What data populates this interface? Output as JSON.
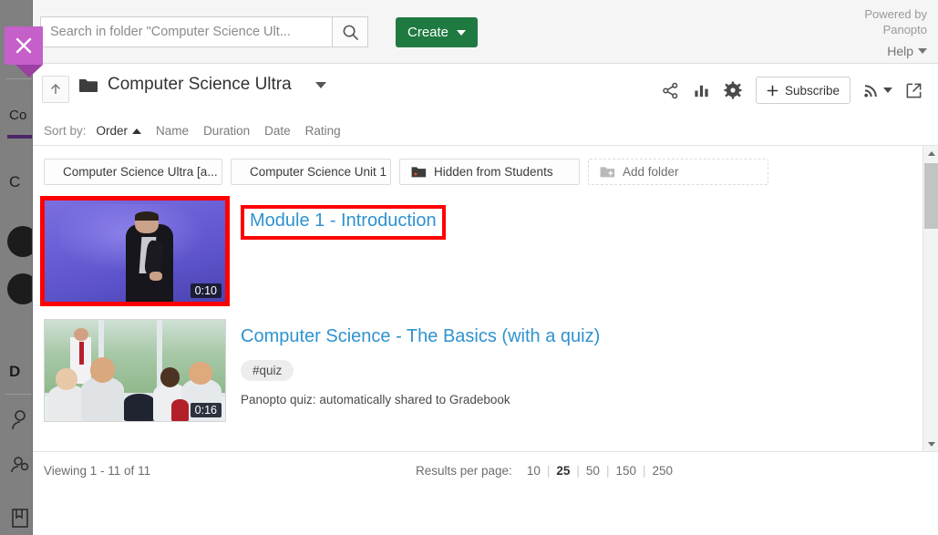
{
  "lms": {
    "course_label": "Co",
    "content_label": "C",
    "details_label": "D"
  },
  "close_button": {
    "icon": "close-icon",
    "label": "Close"
  },
  "header": {
    "search": {
      "placeholder": "Search in folder \"Computer Science Ult...",
      "value": "",
      "search_icon": "search-icon"
    },
    "create_label": "Create",
    "powered_line1": "Powered by",
    "powered_line2": "Panopto",
    "help_label": "Help"
  },
  "folder_bar": {
    "up_icon": "arrow-up-icon",
    "folder_icon": "folder-icon",
    "title": "Computer Science Ultra",
    "actions": {
      "share_icon": "share-icon",
      "stats_icon": "bar-chart-icon",
      "settings_icon": "gear-icon",
      "subscribe_label": "Subscribe",
      "rss_icon": "rss-icon",
      "open_new_icon": "external-link-icon"
    }
  },
  "sort": {
    "label": "Sort by:",
    "items": [
      {
        "label": "Order",
        "active": true,
        "direction": "asc"
      },
      {
        "label": "Name",
        "active": false
      },
      {
        "label": "Duration",
        "active": false
      },
      {
        "label": "Date",
        "active": false
      },
      {
        "label": "Rating",
        "active": false
      }
    ]
  },
  "folders": [
    {
      "label": "Computer Science Ultra [a...",
      "icon": "folder-icon",
      "add": false
    },
    {
      "label": "Computer Science Unit 1",
      "icon": "folder-icon",
      "add": false
    },
    {
      "label": "Hidden from Students",
      "icon": "folder-icon",
      "add": false
    },
    {
      "label": "Add folder",
      "icon": "folder-add-icon",
      "add": true
    }
  ],
  "videos": [
    {
      "title": "Module 1 - Introduction",
      "duration": "0:10",
      "tag": "",
      "description": "",
      "highlighted": true
    },
    {
      "title": "Computer Science - The Basics (with a quiz)",
      "duration": "0:16",
      "tag": "#quiz",
      "description": "Panopto quiz: automatically shared to Gradebook",
      "highlighted": false
    }
  ],
  "footer": {
    "viewing": "Viewing 1 - 11 of 11",
    "results_label": "Results per page:",
    "options": [
      "10",
      "25",
      "50",
      "150",
      "250"
    ],
    "selected": "25"
  },
  "scrollbar": {
    "up_icon": "scroll-up-icon",
    "down_icon": "scroll-down-icon",
    "thumb": "scroll-thumb"
  },
  "colors": {
    "accent_green": "#1f7a41",
    "link_blue": "#2f92d0",
    "highlight_red": "#ff0000",
    "close_purple": "#c55fca"
  }
}
